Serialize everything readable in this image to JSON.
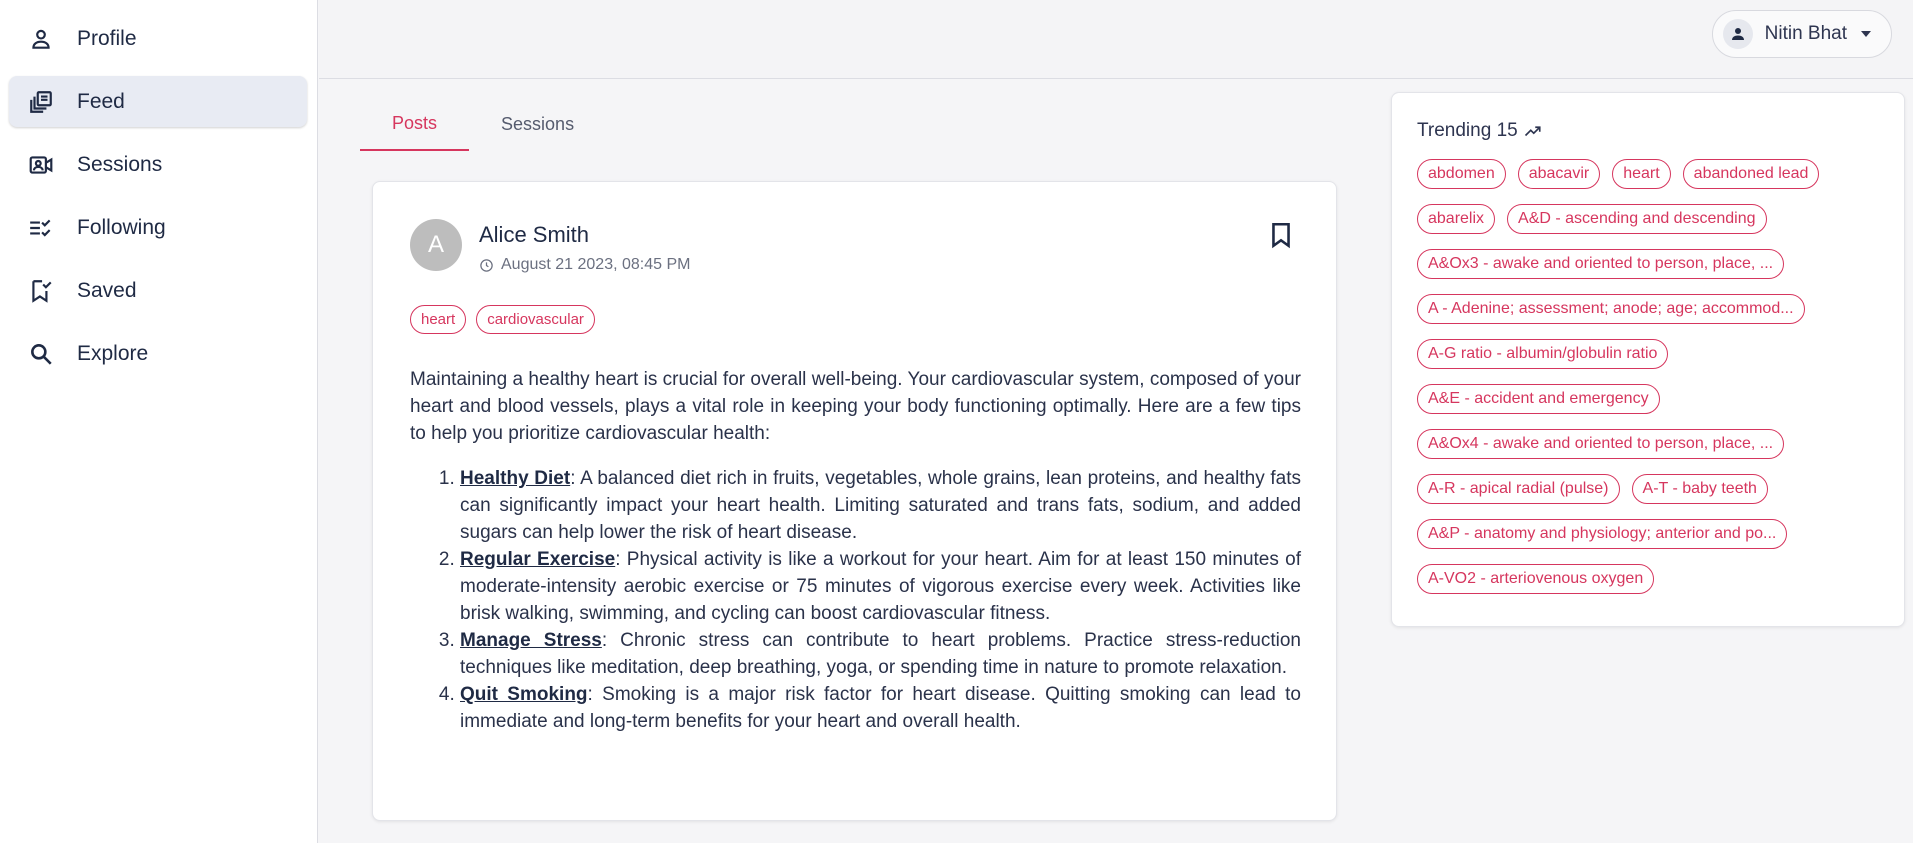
{
  "sidebar": {
    "items": [
      {
        "label": "Profile",
        "icon": "person-icon",
        "active": false
      },
      {
        "label": "Feed",
        "icon": "feed-icon",
        "active": true
      },
      {
        "label": "Sessions",
        "icon": "video-contact-icon",
        "active": false
      },
      {
        "label": "Following",
        "icon": "checklist-icon",
        "active": false
      },
      {
        "label": "Saved",
        "icon": "bookmark-check-icon",
        "active": false
      },
      {
        "label": "Explore",
        "icon": "search-icon",
        "active": false
      }
    ]
  },
  "header": {
    "user_name": "Nitin Bhat",
    "user_icon": "person-icon"
  },
  "tabs": [
    {
      "label": "Posts",
      "active": true
    },
    {
      "label": "Sessions",
      "active": false
    }
  ],
  "post": {
    "avatar_letter": "A",
    "author": "Alice Smith",
    "timestamp": "August 21 2023, 08:45 PM",
    "tags": [
      "heart",
      "cardiovascular"
    ],
    "intro": "Maintaining a healthy heart is crucial for overall well-being. Your cardiovascular system, composed of your heart and blood vessels, plays a vital role in keeping your body functioning optimally. Here are a few tips to help you prioritize cardiovascular health:",
    "tips": [
      {
        "title": "Healthy Diet",
        "text": ": A balanced diet rich in fruits, vegetables, whole grains, lean proteins, and healthy fats can significantly impact your heart health. Limiting saturated and trans fats, sodium, and added sugars can help lower the risk of heart disease."
      },
      {
        "title": "Regular Exercise",
        "text": ": Physical activity is like a workout for your heart. Aim for at least 150 minutes of moderate-intensity aerobic exercise or 75 minutes of vigorous exercise every week. Activities like brisk walking, swimming, and cycling can boost cardiovascular fitness."
      },
      {
        "title": "Manage Stress",
        "text": ": Chronic stress can contribute to heart problems. Practice stress-reduction techniques like meditation, deep breathing, yoga, or spending time in nature to promote relaxation."
      },
      {
        "title": "Quit Smoking",
        "text": ": Smoking is a major risk factor for heart disease. Quitting smoking can lead to immediate and long-term benefits for your heart and overall health."
      }
    ]
  },
  "trending": {
    "title": "Trending 15",
    "icon": "trending-up-icon",
    "tags": [
      "abdomen",
      "abacavir",
      "heart",
      "abandoned lead",
      "abarelix",
      "A&D - ascending and descending",
      "A&Ox3 - awake and oriented to person, place, ...",
      "A - Adenine; assessment; anode; age; accommod...",
      "A-G ratio - albumin/globulin ratio",
      "A&E - accident and emergency",
      "A&Ox4 - awake and oriented to person, place, ...",
      "A-R - apical radial (pulse)",
      "A-T - baby teeth",
      "A&P - anatomy and physiology; anterior and po...",
      "A-VO2 - arteriovenous oxygen"
    ]
  },
  "colors": {
    "accent": "#d6365e",
    "text": "#1f2a44",
    "active_nav_bg": "#e8ebf3"
  }
}
